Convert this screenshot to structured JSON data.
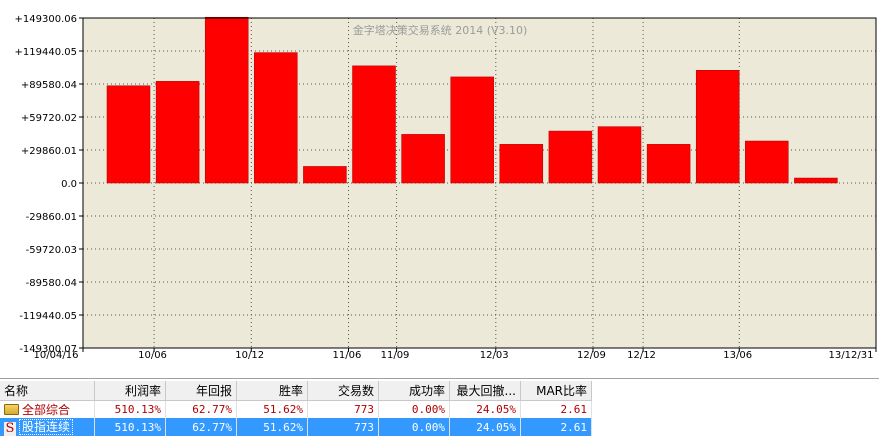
{
  "chart_data": {
    "type": "bar",
    "title": "金字塔决策交易系统 2014 (V3.10)",
    "yticks": [
      "+149300.06",
      "+119440.05",
      "+89580.04",
      "+59720.02",
      "+29860.01",
      "0.0",
      "-29860.01",
      "-59720.03",
      "-89580.04",
      "-119440.05",
      "-149300.07"
    ],
    "ylim": [
      -149300.07,
      149300.06
    ],
    "xticks": [
      "10/04/16",
      "10/06",
      "10/12",
      "11/06",
      "11/09",
      "12/03",
      "12/09",
      "12/12",
      "13/06",
      "13/12/31"
    ],
    "values": [
      88000,
      92000,
      150000,
      118000,
      15000,
      106000,
      44000,
      96000,
      35000,
      47000,
      51000,
      35000,
      102000,
      38000,
      4500
    ],
    "grid": "dotted",
    "bar_color": "#ff0000",
    "background": "#ece9d8"
  },
  "table": {
    "headers": [
      "名称",
      "利润率",
      "年回报",
      "胜率",
      "交易数",
      "成功率",
      "最大回撤...",
      "MAR比率"
    ],
    "rows": [
      {
        "icon": "folder-icon",
        "name": "全部综合",
        "values": [
          "510.13%",
          "62.77%",
          "51.62%",
          "773",
          "0.00%",
          "24.05%",
          "2.61"
        ]
      },
      {
        "icon": "s-icon",
        "icon_text": "S",
        "name": "股指连续",
        "values": [
          "510.13%",
          "62.77%",
          "51.62%",
          "773",
          "0.00%",
          "24.05%",
          "2.61"
        ]
      }
    ]
  }
}
